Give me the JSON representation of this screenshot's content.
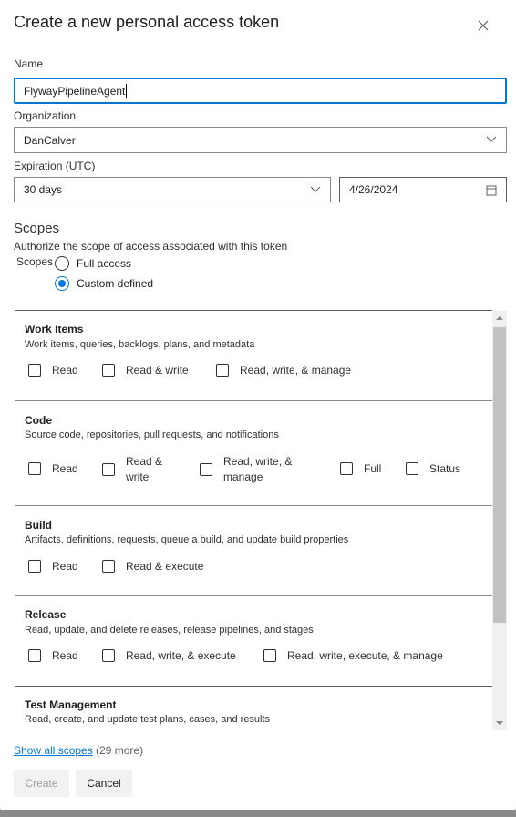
{
  "title": "Create a new personal access token",
  "name": {
    "label": "Name",
    "value": "FlywayPipelineAgent"
  },
  "organization": {
    "label": "Organization",
    "value": "DanCalver"
  },
  "expiration": {
    "label": "Expiration (UTC)",
    "value": "30 days",
    "date": "4/26/2024"
  },
  "scopes": {
    "heading": "Scopes",
    "description": "Authorize the scope of access associated with this token",
    "radio_label": "Scopes",
    "options": [
      {
        "label": "Full access",
        "selected": false
      },
      {
        "label": "Custom defined",
        "selected": true
      }
    ],
    "sections": [
      {
        "title": "Work Items",
        "description": "Work items, queries, backlogs, plans, and metadata",
        "checks": [
          "Read",
          "Read & write",
          "Read, write, & manage"
        ]
      },
      {
        "title": "Code",
        "description": "Source code, repositories, pull requests, and notifications",
        "checks": [
          "Read",
          "Read & write",
          "Read, write, & manage",
          "Full",
          "Status"
        ]
      },
      {
        "title": "Build",
        "description": "Artifacts, definitions, requests, queue a build, and update build properties",
        "checks": [
          "Read",
          "Read & execute"
        ]
      },
      {
        "title": "Release",
        "description": "Read, update, and delete releases, release pipelines, and stages",
        "checks": [
          "Read",
          "Read, write, & execute",
          "Read, write, execute, & manage"
        ]
      },
      {
        "title": "Test Management",
        "description": "Read, create, and update test plans, cases, and results",
        "checks": []
      }
    ],
    "show_all_link": "Show all scopes",
    "more_count": "(29 more)"
  },
  "buttons": {
    "create": "Create",
    "cancel": "Cancel"
  },
  "colors": {
    "accent": "#0078d4",
    "link": "#0078d4"
  }
}
